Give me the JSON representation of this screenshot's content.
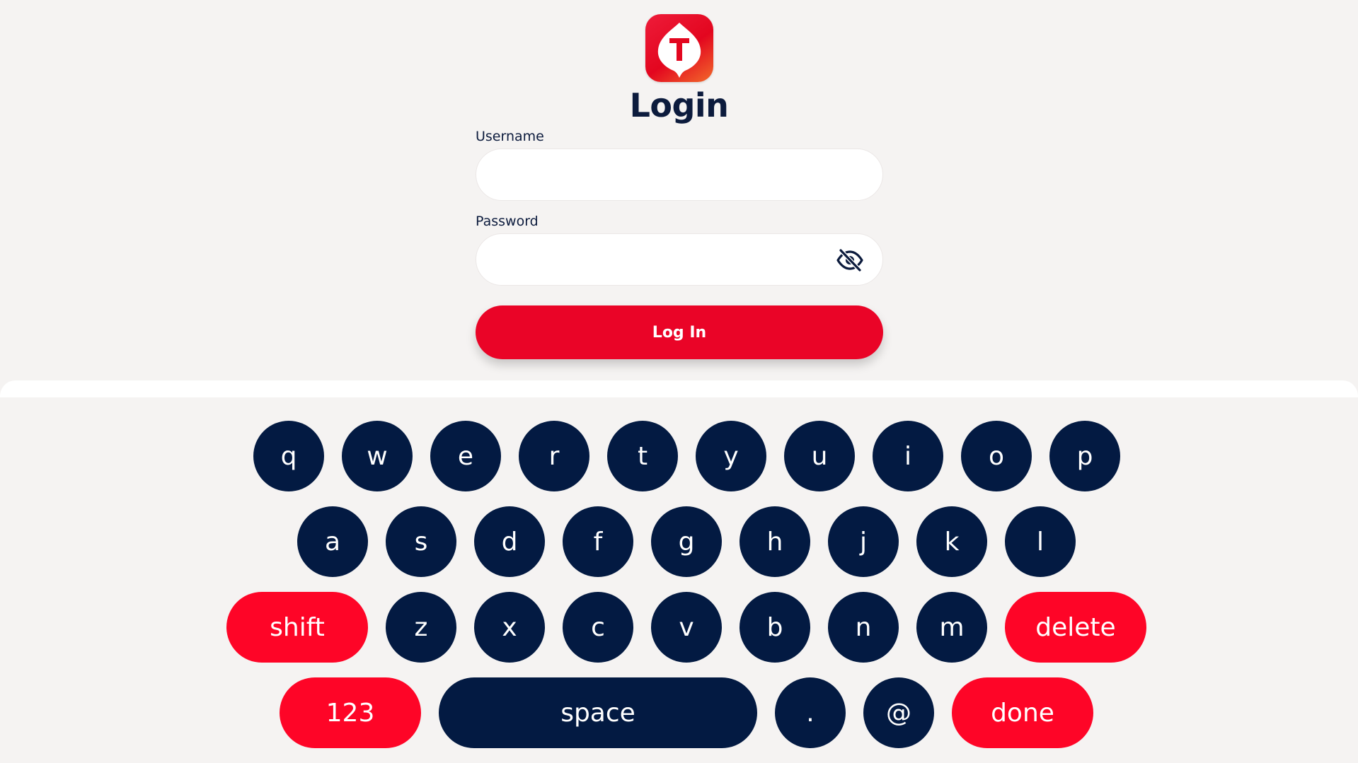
{
  "form": {
    "title": "Login",
    "username_label": "Username",
    "username_value": "",
    "password_label": "Password",
    "password_value": "",
    "password_toggle_icon": "eye-slash-icon",
    "login_button": "Log In"
  },
  "logo": {
    "icon": "brand-logo-icon",
    "letter": "T"
  },
  "colors": {
    "primary_red": "#ea0427",
    "key_red": "#fe0527",
    "key_navy": "#031a42",
    "text_navy": "#0c1b3d",
    "background": "#f5f3f2"
  },
  "keyboard": {
    "row1": [
      "q",
      "w",
      "e",
      "r",
      "t",
      "y",
      "u",
      "i",
      "o",
      "p"
    ],
    "row2": [
      "a",
      "s",
      "d",
      "f",
      "g",
      "h",
      "j",
      "k",
      "l"
    ],
    "row3": [
      "z",
      "x",
      "c",
      "v",
      "b",
      "n",
      "m"
    ],
    "shift": "shift",
    "delete": "delete",
    "numbers": "123",
    "space": "space",
    "period": ".",
    "at": "@",
    "done": "done"
  }
}
